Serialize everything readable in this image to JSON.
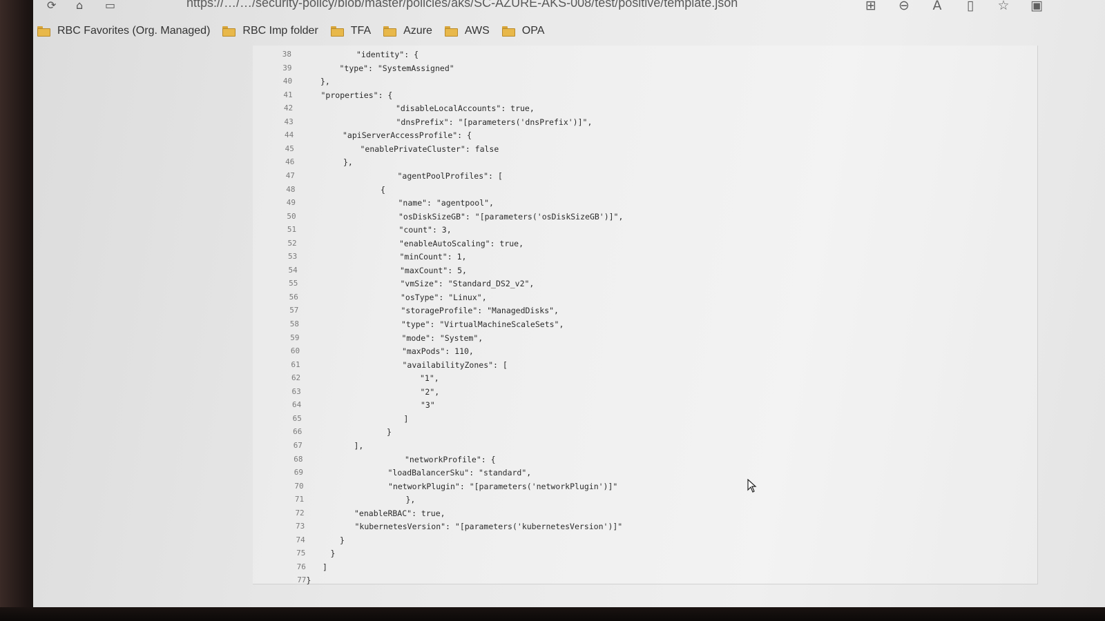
{
  "browser": {
    "url": "https://…/…/security-policy/blob/master/policies/aks/SC-AZURE-AKS-008/test/positive/template.json",
    "toolbar_icons": [
      "apps-icon",
      "zoom-out-icon",
      "read-aloud-icon",
      "immersive-reader-icon",
      "favorite-star-icon",
      "extension-icon"
    ]
  },
  "favorites": [
    {
      "label": "RBC Favorites (Org. Managed)"
    },
    {
      "label": "RBC Imp folder"
    },
    {
      "label": "TFA"
    },
    {
      "label": "Azure"
    },
    {
      "label": "AWS"
    },
    {
      "label": "OPA"
    }
  ],
  "code_lines": [
    {
      "n": "38",
      "text": "\"identity\": {"
    },
    {
      "n": "39",
      "text": "\"type\": \"SystemAssigned\""
    },
    {
      "n": "40",
      "text": "},"
    },
    {
      "n": "41",
      "text": "\"properties\": {"
    },
    {
      "n": "42",
      "text": "\"disableLocalAccounts\": true,"
    },
    {
      "n": "43",
      "text": "\"dnsPrefix\": \"[parameters('dnsPrefix')]\","
    },
    {
      "n": "44",
      "text": "\"apiServerAccessProfile\": {"
    },
    {
      "n": "45",
      "text": "\"enablePrivateCluster\": false"
    },
    {
      "n": "46",
      "text": "},"
    },
    {
      "n": "47",
      "text": "\"agentPoolProfiles\": ["
    },
    {
      "n": "48",
      "text": "{"
    },
    {
      "n": "49",
      "text": "\"name\": \"agentpool\","
    },
    {
      "n": "50",
      "text": "\"osDiskSizeGB\": \"[parameters('osDiskSizeGB')]\","
    },
    {
      "n": "51",
      "text": "\"count\": 3,"
    },
    {
      "n": "52",
      "text": "\"enableAutoScaling\": true,"
    },
    {
      "n": "53",
      "text": "\"minCount\": 1,"
    },
    {
      "n": "54",
      "text": "\"maxCount\": 5,"
    },
    {
      "n": "55",
      "text": "\"vmSize\": \"Standard_DS2_v2\","
    },
    {
      "n": "56",
      "text": "\"osType\": \"Linux\","
    },
    {
      "n": "57",
      "text": "\"storageProfile\": \"ManagedDisks\","
    },
    {
      "n": "58",
      "text": "\"type\": \"VirtualMachineScaleSets\","
    },
    {
      "n": "59",
      "text": "\"mode\": \"System\","
    },
    {
      "n": "60",
      "text": "\"maxPods\": 110,"
    },
    {
      "n": "61",
      "text": "\"availabilityZones\": ["
    },
    {
      "n": "62",
      "text": "\"1\","
    },
    {
      "n": "63",
      "text": "\"2\","
    },
    {
      "n": "64",
      "text": "\"3\""
    },
    {
      "n": "65",
      "text": "]"
    },
    {
      "n": "66",
      "text": "}"
    },
    {
      "n": "67",
      "text": "],"
    },
    {
      "n": "68",
      "text": "\"networkProfile\": {"
    },
    {
      "n": "69",
      "text": "\"loadBalancerSku\": \"standard\","
    },
    {
      "n": "70",
      "text": "\"networkPlugin\": \"[parameters('networkPlugin')]\""
    },
    {
      "n": "71",
      "text": "},"
    },
    {
      "n": "72",
      "text": "\"enableRBAC\": true,"
    },
    {
      "n": "73",
      "text": "\"kubernetesVersion\": \"[parameters('kubernetesVersion')]\""
    },
    {
      "n": "74",
      "text": "}"
    },
    {
      "n": "75",
      "text": "}"
    },
    {
      "n": "76",
      "text": "]"
    },
    {
      "n": "77",
      "text": "}"
    }
  ]
}
